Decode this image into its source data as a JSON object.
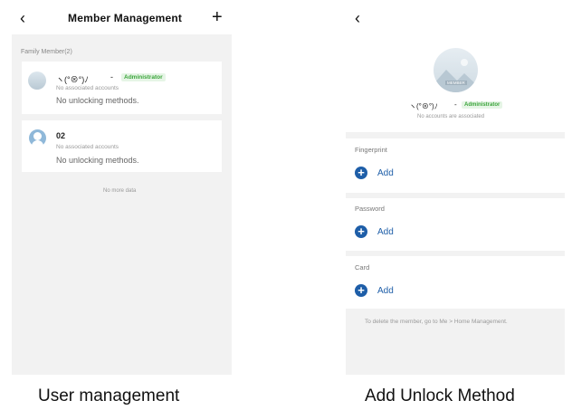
{
  "left": {
    "back_icon": "chevron-left-icon",
    "title": "Member Management",
    "add_icon": "plus-icon",
    "section_label": "Family Member(2)",
    "members": [
      {
        "name": "ヽ(°⊗°)ﾉ",
        "badge": "Administrator",
        "accounts": "No associated accounts",
        "methods": "No unlocking methods."
      },
      {
        "name": "02",
        "badge": "",
        "accounts": "No associated accounts",
        "methods": "No unlocking methods."
      }
    ],
    "footer": "No more data"
  },
  "right": {
    "back_icon": "chevron-left-icon",
    "avatar_badge": "MEMBER",
    "name": "ヽ(°⊗°)ﾉ",
    "badge": "Administrator",
    "accounts": "No accounts are associated",
    "sections": [
      {
        "title": "Fingerprint",
        "add_label": "Add"
      },
      {
        "title": "Password",
        "add_label": "Add"
      },
      {
        "title": "Card",
        "add_label": "Add"
      }
    ],
    "note": "To delete the member, go to Me > Home Management."
  },
  "captions": {
    "left": "User management",
    "right": "Add Unlock Method"
  },
  "colors": {
    "accent_blue": "#1e5ea8",
    "badge_green": "#3ba53b",
    "background_gray": "#f2f2f2"
  }
}
